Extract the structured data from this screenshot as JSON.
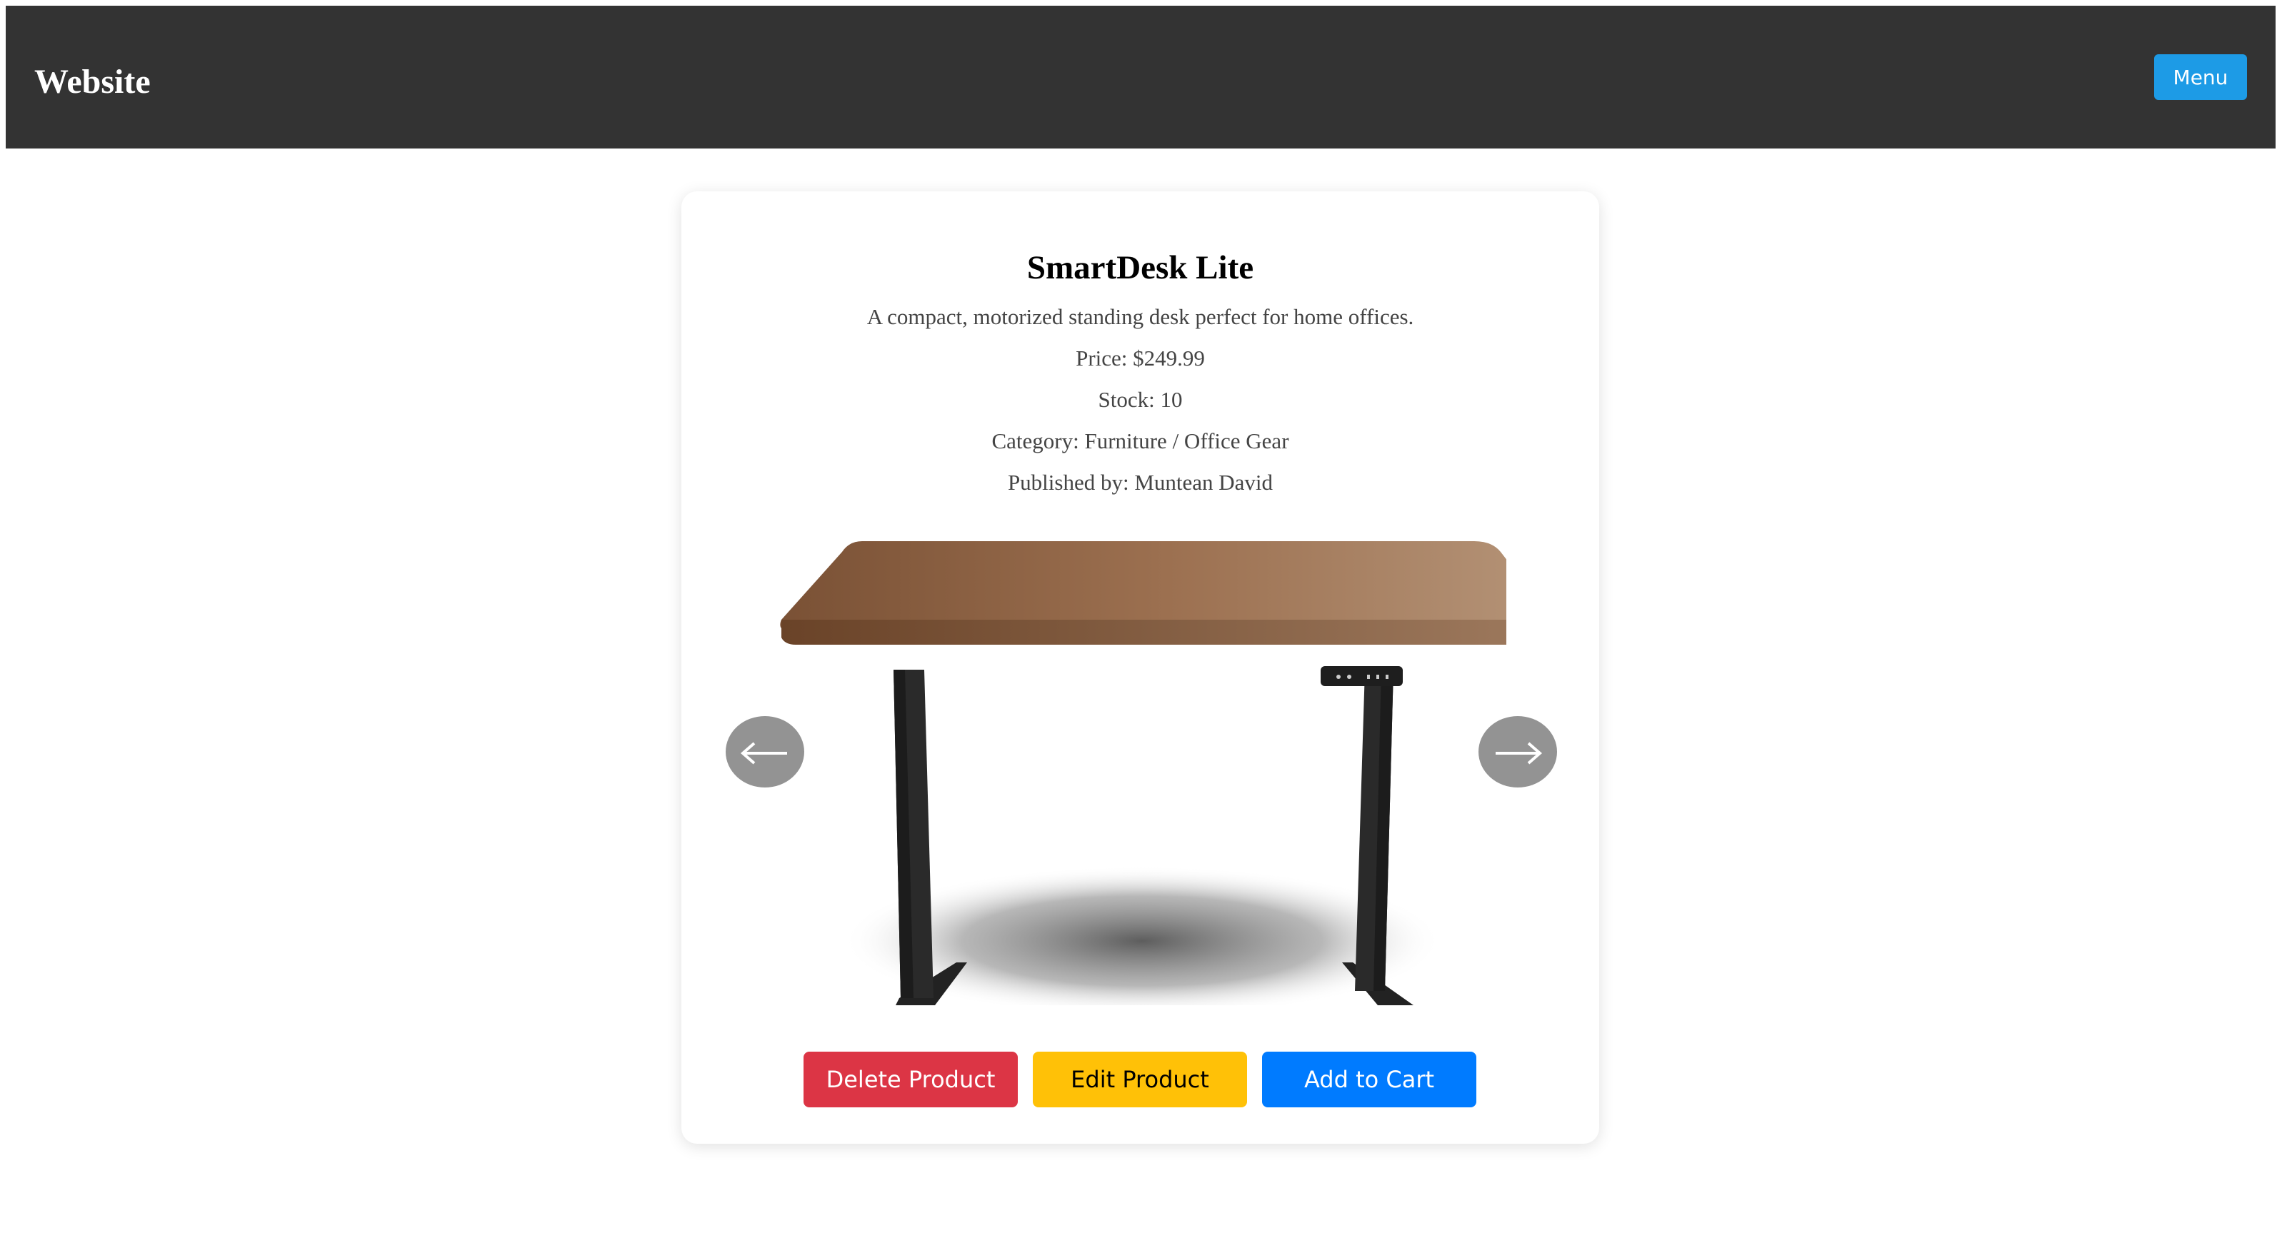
{
  "header": {
    "brand": "Website",
    "menu_label": "Menu",
    "background": "#333333",
    "menu_color": "#1d9be6"
  },
  "product": {
    "title": "SmartDesk Lite",
    "description": "A compact, motorized standing desk perfect for home offices.",
    "price": "Price: $249.99",
    "stock": "Stock: 10",
    "category": "Category: Furniture / Office Gear",
    "publisher": "Published by: Muntean David",
    "image_alt": "standing desk with wooden top and black legs"
  },
  "carousel": {
    "prev_icon": "arrow-left-icon",
    "next_icon": "arrow-right-icon"
  },
  "actions": {
    "delete_label": "Delete Product",
    "edit_label": "Edit Product",
    "cart_label": "Add to Cart",
    "delete_color": "#dc3545",
    "edit_color": "#ffc107",
    "cart_color": "#007bff"
  }
}
